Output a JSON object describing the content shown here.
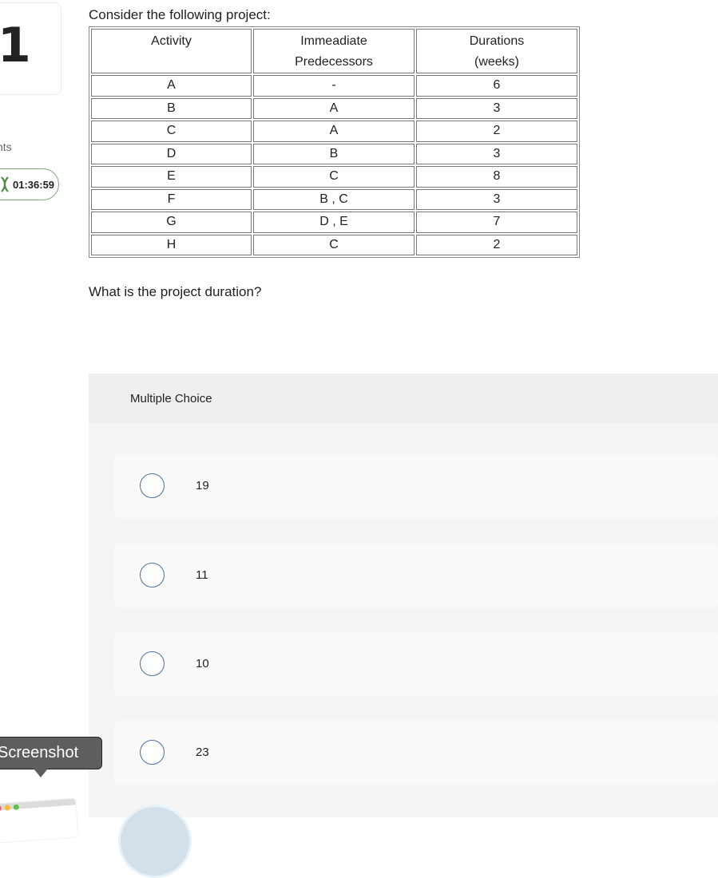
{
  "sidebar": {
    "question_number": "1",
    "points_label": "nts",
    "timer": "01:36:59"
  },
  "question": {
    "intro": "Consider the following project:",
    "table": {
      "headers": [
        "Activity",
        "Immeadiate Predecessors",
        "Durations (weeks)"
      ],
      "header_lines": [
        [
          "Activity"
        ],
        [
          "Immeadiate",
          "Predecessors"
        ],
        [
          "Durations",
          "(weeks)"
        ]
      ],
      "rows": [
        [
          "A",
          "-",
          "6"
        ],
        [
          "B",
          "A",
          "3"
        ],
        [
          "C",
          "A",
          "2"
        ],
        [
          "D",
          "B",
          "3"
        ],
        [
          "E",
          "C",
          "8"
        ],
        [
          "F",
          "B , C",
          "3"
        ],
        [
          "G",
          "D , E",
          "7"
        ],
        [
          "H",
          "C",
          "2"
        ]
      ]
    },
    "prompt": "What is the project duration?"
  },
  "answers": {
    "type_label": "Multiple Choice",
    "options": [
      {
        "label": "19",
        "selected": false
      },
      {
        "label": "11",
        "selected": false
      },
      {
        "label": "10",
        "selected": false
      },
      {
        "label": "23",
        "selected": false
      }
    ]
  },
  "overlay": {
    "tooltip": "Screenshot"
  },
  "colors": {
    "timer_border": "#7fa87a",
    "timer_icon": "#4e8a46",
    "radio_border": "#4a6fa5",
    "panel_bg": "#f5f5f5",
    "option_bg": "#fafafa"
  }
}
